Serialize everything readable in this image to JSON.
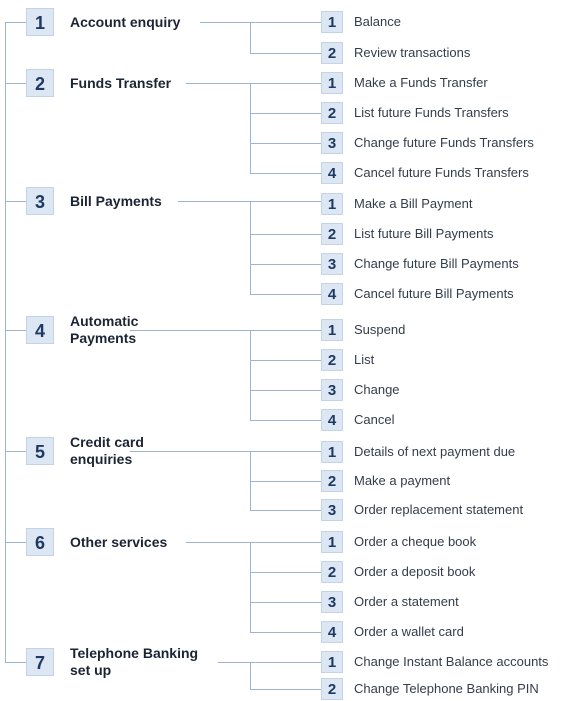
{
  "menu": [
    {
      "number": "1",
      "label": [
        "Account enquiry"
      ],
      "options": [
        {
          "number": "1",
          "label": "Balance"
        },
        {
          "number": "2",
          "label": "Review transactions"
        }
      ]
    },
    {
      "number": "2",
      "label": [
        "Funds Transfer"
      ],
      "options": [
        {
          "number": "1",
          "label": "Make a Funds Transfer"
        },
        {
          "number": "2",
          "label": "List future Funds Transfers"
        },
        {
          "number": "3",
          "label": "Change future Funds Transfers"
        },
        {
          "number": "4",
          "label": "Cancel future Funds Transfers"
        }
      ]
    },
    {
      "number": "3",
      "label": [
        "Bill Payments"
      ],
      "options": [
        {
          "number": "1",
          "label": "Make a Bill Payment"
        },
        {
          "number": "2",
          "label": "List future Bill Payments"
        },
        {
          "number": "3",
          "label": "Change future Bill Payments"
        },
        {
          "number": "4",
          "label": "Cancel future Bill Payments"
        }
      ]
    },
    {
      "number": "4",
      "label": [
        "Automatic",
        "Payments"
      ],
      "options": [
        {
          "number": "1",
          "label": "Suspend"
        },
        {
          "number": "2",
          "label": "List"
        },
        {
          "number": "3",
          "label": "Change"
        },
        {
          "number": "4",
          "label": "Cancel"
        }
      ]
    },
    {
      "number": "5",
      "label": [
        "Credit card",
        "enquiries"
      ],
      "options": [
        {
          "number": "1",
          "label": "Details of next payment due"
        },
        {
          "number": "2",
          "label": "Make a payment"
        },
        {
          "number": "3",
          "label": "Order replacement statement"
        }
      ]
    },
    {
      "number": "6",
      "label": [
        "Other services"
      ],
      "options": [
        {
          "number": "1",
          "label": "Order a cheque book"
        },
        {
          "number": "2",
          "label": "Order a deposit book"
        },
        {
          "number": "3",
          "label": "Order a statement"
        },
        {
          "number": "4",
          "label": "Order a wallet card"
        }
      ]
    },
    {
      "number": "7",
      "label": [
        "Telephone Banking",
        "set up"
      ],
      "options": [
        {
          "number": "1",
          "label": "Change Instant Balance accounts"
        },
        {
          "number": "2",
          "label": "Change Telephone Banking PIN"
        }
      ]
    }
  ],
  "colors": {
    "line": "#9db5d3",
    "badge_bg": "#dde7f4",
    "badge_text": "#1f3a62"
  }
}
